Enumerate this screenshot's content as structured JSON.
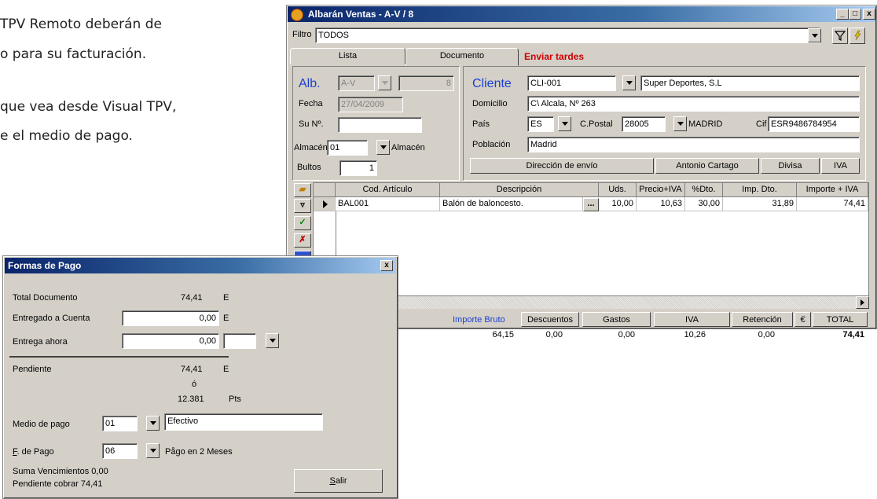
{
  "background_text": [
    "TPV Remoto deberán de",
    "o para su facturación.",
    "que vea desde Visual TPV,",
    "e el medio de pago."
  ],
  "albaran": {
    "title": "Albarán Ventas - A-V / 8",
    "window_controls": [
      "_",
      "□",
      "x"
    ],
    "filter_label": "Filtro",
    "filter_value": "TODOS",
    "tabs": [
      "Lista",
      "Documento",
      "Enviar tardes"
    ],
    "doc": {
      "alb_label": "Alb.",
      "series": "A-V",
      "number": "8",
      "fecha_label": "Fecha",
      "fecha": "27/04/2009",
      "su_no_label": "Su Nº.",
      "su_no": "",
      "almacen_label": "Almacén",
      "almacen_code": "01",
      "almacen_name": "Almacén",
      "bultos_label": "Bultos",
      "bultos": "1"
    },
    "client": {
      "cliente_label": "Cliente",
      "code": "CLI-001",
      "name": "Super Deportes, S.L",
      "domicilio_label": "Domicilio",
      "domicilio": "C\\ Alcala, Nº 263",
      "pais_label": "País",
      "pais": "ES",
      "cpostal_label": "C.Postal",
      "cpostal": "28005",
      "city": "MADRID",
      "cif_label": "Cif",
      "cif": "ESR9486784954",
      "poblacion_label": "Población",
      "poblacion": "Madrid",
      "buttons": [
        "Dirección de envío",
        "Antonio Cartago",
        "Divisa",
        "IVA"
      ]
    },
    "grid": {
      "headers": [
        "Cod. Artículo",
        "Descripción",
        "Uds.",
        "Precio+IVA",
        "%Dto.",
        "Imp. Dto.",
        "Importe + IVA"
      ],
      "rows": [
        {
          "cod": "BAL001",
          "desc": "Balón de baloncesto.",
          "ellipsis": "...",
          "uds": "10,00",
          "precio": "10,63",
          "dto": "30,00",
          "imp_dto": "31,89",
          "importe": "74,41"
        }
      ]
    },
    "totals": {
      "labels": [
        "Importe Bruto",
        "Descuentos",
        "Gastos",
        "IVA",
        "Retención",
        "€",
        "TOTAL"
      ],
      "values": [
        "64,15",
        "0,00",
        "0,00",
        "10,26",
        "0,00",
        "",
        "74,41"
      ]
    }
  },
  "formas_pago": {
    "title": "Formas de Pago",
    "close": "x",
    "total_documento_label": "Total Documento",
    "total_documento": "74,41",
    "currency": "E",
    "entregado_label": "Entregado a Cuenta",
    "entregado": "0,00",
    "entrega_ahora_label": "Entrega ahora",
    "entrega_ahora": "0,00",
    "pendiente_label": "Pendiente",
    "pendiente": "74,41",
    "o_label": "ó",
    "pts_value": "12.381",
    "pts_label": "Pts",
    "medio_label": "Medio de pago",
    "medio_code": "01",
    "medio_name": "Efectivo",
    "fpago_label": "F. de Pago",
    "fpago_code": "06",
    "fpago_name": "Pågo en 2 Meses",
    "suma_venc": "Suma Vencimientos 0,00",
    "pendiente_cobrar": "Pendiente cobrar 74,41",
    "salir": "Salir"
  },
  "colors": {
    "titlebar": "#0a246a",
    "face": "#d4d0c8",
    "label_blue": "#1c3fd0",
    "tab_red": "#cc0000"
  }
}
